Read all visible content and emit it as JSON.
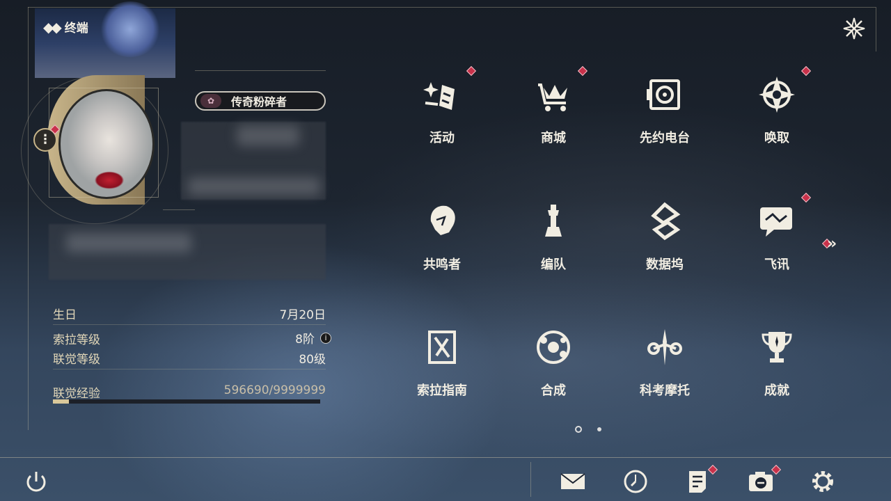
{
  "header": {
    "title": "终端",
    "title_icon": "diamond-cluster-icon",
    "close_icon": "close-icon"
  },
  "profile": {
    "title_badge": "传奇粉碎者",
    "menu_icon": "more-dots-icon"
  },
  "stats": {
    "birthday_label": "生日",
    "birthday_value": "7月20日",
    "sola_level_label": "索拉等级",
    "sola_level_value": "8阶",
    "union_level_label": "联觉等级",
    "union_level_value": "80级",
    "union_exp_label": "联觉经验",
    "union_exp_value": "596690/9999999",
    "union_exp_progress": 0.06
  },
  "menu": {
    "items": [
      {
        "label": "活动",
        "icon": "sparkle-flag-icon",
        "badge": true
      },
      {
        "label": "商城",
        "icon": "crown-cart-icon",
        "badge": true
      },
      {
        "label": "先约电台",
        "icon": "radio-icon",
        "badge": false
      },
      {
        "label": "唤取",
        "icon": "compass-star-icon",
        "badge": true
      },
      {
        "label": "共鸣者",
        "icon": "character-head-icon",
        "badge": false
      },
      {
        "label": "编队",
        "icon": "chess-pieces-icon",
        "badge": false
      },
      {
        "label": "数据坞",
        "icon": "data-dock-icon",
        "badge": false
      },
      {
        "label": "飞讯",
        "icon": "chat-bubble-icon",
        "badge": true
      },
      {
        "label": "索拉指南",
        "icon": "guide-book-icon",
        "badge": false
      },
      {
        "label": "合成",
        "icon": "synthesis-icon",
        "badge": false
      },
      {
        "label": "科考摩托",
        "icon": "motorbike-icon",
        "badge": false
      },
      {
        "label": "成就",
        "icon": "trophy-icon",
        "badge": false
      }
    ],
    "next_page_icon": "double-chevron-right-icon",
    "page_count": 2,
    "current_page": 1
  },
  "bottom_bar": {
    "icons": [
      "power-icon",
      "mail-icon",
      "clock-icon",
      "notice-icon",
      "camera-icon",
      "settings-icon"
    ]
  },
  "colors": {
    "accent_gold": "#c8b58a",
    "badge_red": "#c8314a",
    "text_primary": "#f1ede2"
  }
}
